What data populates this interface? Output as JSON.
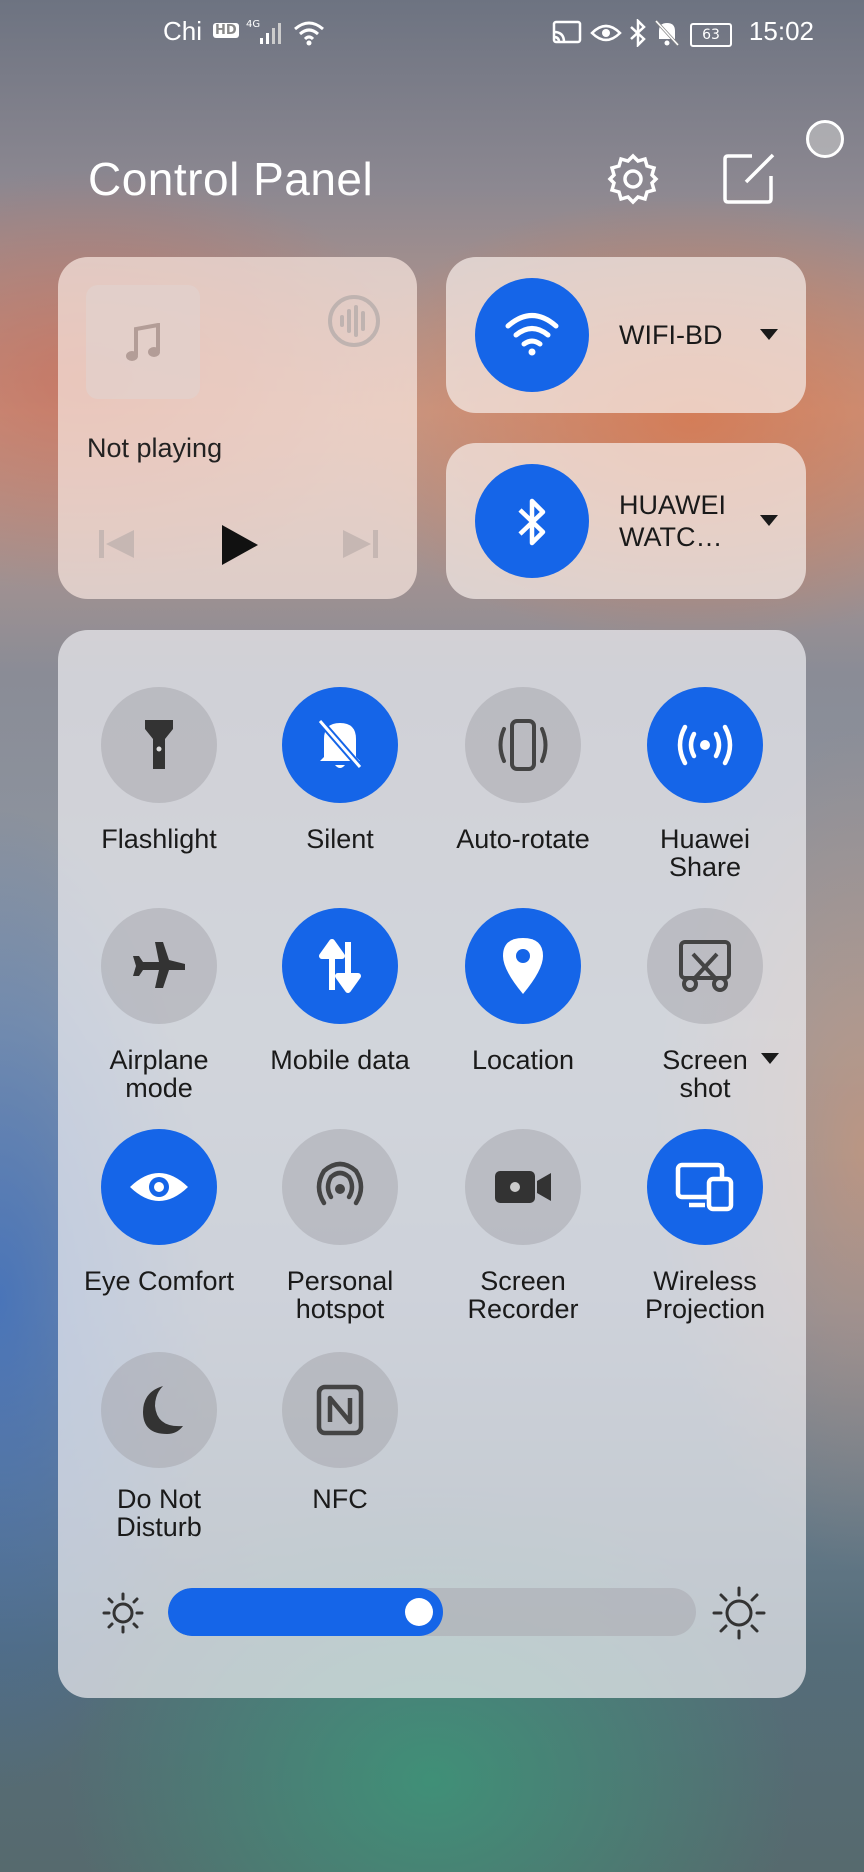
{
  "status_bar": {
    "carrier": "Chi",
    "hd_badge": "HD",
    "network": "4G",
    "battery": "63",
    "time": "15:02"
  },
  "header": {
    "title": "Control Panel"
  },
  "media": {
    "status": "Not playing"
  },
  "wifi": {
    "label": "WIFI-BD"
  },
  "bluetooth": {
    "label_line1": "HUAWEI",
    "label_line2": "WATC…"
  },
  "toggles": [
    {
      "label": "Flashlight",
      "on": false,
      "icon": "flashlight-icon"
    },
    {
      "label": "Silent",
      "on": true,
      "icon": "silent-bell-icon"
    },
    {
      "label": "Auto-rotate",
      "on": false,
      "icon": "auto-rotate-icon"
    },
    {
      "label": "Huawei Share",
      "on": true,
      "icon": "huawei-share-icon"
    },
    {
      "label": "Airplane mode",
      "on": false,
      "icon": "airplane-icon"
    },
    {
      "label": "Mobile data",
      "on": true,
      "icon": "mobile-data-icon"
    },
    {
      "label": "Location",
      "on": true,
      "icon": "location-icon"
    },
    {
      "label": "Screen shot",
      "on": false,
      "icon": "screenshot-icon"
    },
    {
      "label": "Eye Comfort",
      "on": true,
      "icon": "eye-icon"
    },
    {
      "label": "Personal hotspot",
      "on": false,
      "icon": "hotspot-icon"
    },
    {
      "label": "Screen Recorder",
      "on": false,
      "icon": "video-icon"
    },
    {
      "label": "Wireless Projection",
      "on": true,
      "icon": "projection-icon"
    },
    {
      "label": "Do Not Disturb",
      "on": false,
      "icon": "moon-icon"
    },
    {
      "label": "NFC",
      "on": false,
      "icon": "nfc-icon"
    }
  ],
  "labels": {
    "flashlight": "Flashlight",
    "silent": "Silent",
    "autorotate": "Auto-rotate",
    "share1": "Huawei",
    "share2": "Share",
    "airplane1": "Airplane",
    "airplane2": "mode",
    "mobiledata": "Mobile data",
    "location": "Location",
    "screenshot1": "Screen",
    "screenshot2": "shot",
    "eyecomfort": "Eye Comfort",
    "hotspot1": "Personal",
    "hotspot2": "hotspot",
    "recorder1": "Screen",
    "recorder2": "Recorder",
    "projection1": "Wireless",
    "projection2": "Projection",
    "dnd1": "Do Not",
    "dnd2": "Disturb",
    "nfc": "NFC"
  },
  "brightness": {
    "level": 0.52
  },
  "colors": {
    "accent": "#1565e8",
    "tile_off": "#a0a0a6",
    "text": "#1a1a1a"
  }
}
